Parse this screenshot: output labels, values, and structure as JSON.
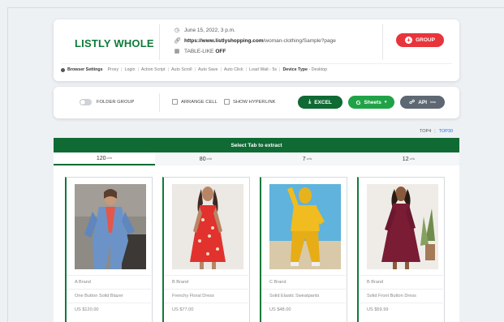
{
  "header": {
    "logo": "LISTLY WHOLE",
    "date": "June 15, 2022, 3 p.m.",
    "url_bold": "https://www.listlyshopping.com",
    "url_rest": "/woman-clothing/Sample?page",
    "table_like_label": "TABLE-LIKE",
    "table_like_value": "OFF",
    "group_button": "GROUP"
  },
  "settings": {
    "title": "Browser Settings",
    "items": [
      "Proxy",
      "Login",
      "Action Script",
      "Auto Scroll",
      "Auto Save",
      "Auto Click",
      "Load Wait - 5s"
    ],
    "device_label": "Device Type",
    "device_value": "Desktop"
  },
  "toolbar": {
    "folder_group": "FOLDER GROUP",
    "arrange_cell": "ARRANGE CELL",
    "show_hyperlink": "SHOW HYPERLINK",
    "excel": "EXCEL",
    "sheets": "Sheets",
    "api": "API",
    "api_badge": "beta"
  },
  "top_links": {
    "top4": "TOP4",
    "top30": "TOP30"
  },
  "select_tab_label": "Select Tab to extract",
  "tabs": [
    {
      "count": "120",
      "unit": "cells"
    },
    {
      "count": "80",
      "unit": "cells"
    },
    {
      "count": "7",
      "unit": "cells"
    },
    {
      "count": "12",
      "unit": "cells"
    }
  ],
  "products": [
    {
      "brand": "A Brand",
      "name": "One Button Solid Blazer",
      "price": "US $120.00"
    },
    {
      "brand": "B Brand",
      "name": "Frenchy Floral Dress",
      "price": "US $77.00"
    },
    {
      "brand": "C Brand",
      "name": "Solid Elastic Sweatpants",
      "price": "US $48.00"
    },
    {
      "brand": "B Brand",
      "name": "Solid Front Button Dress",
      "price": "US $59.99"
    }
  ],
  "colors": {
    "brand_green": "#0f6a33",
    "sheets_green": "#20a347",
    "group_red": "#e8343b",
    "api_gray": "#5d6873",
    "link_blue": "#1a73e8"
  }
}
